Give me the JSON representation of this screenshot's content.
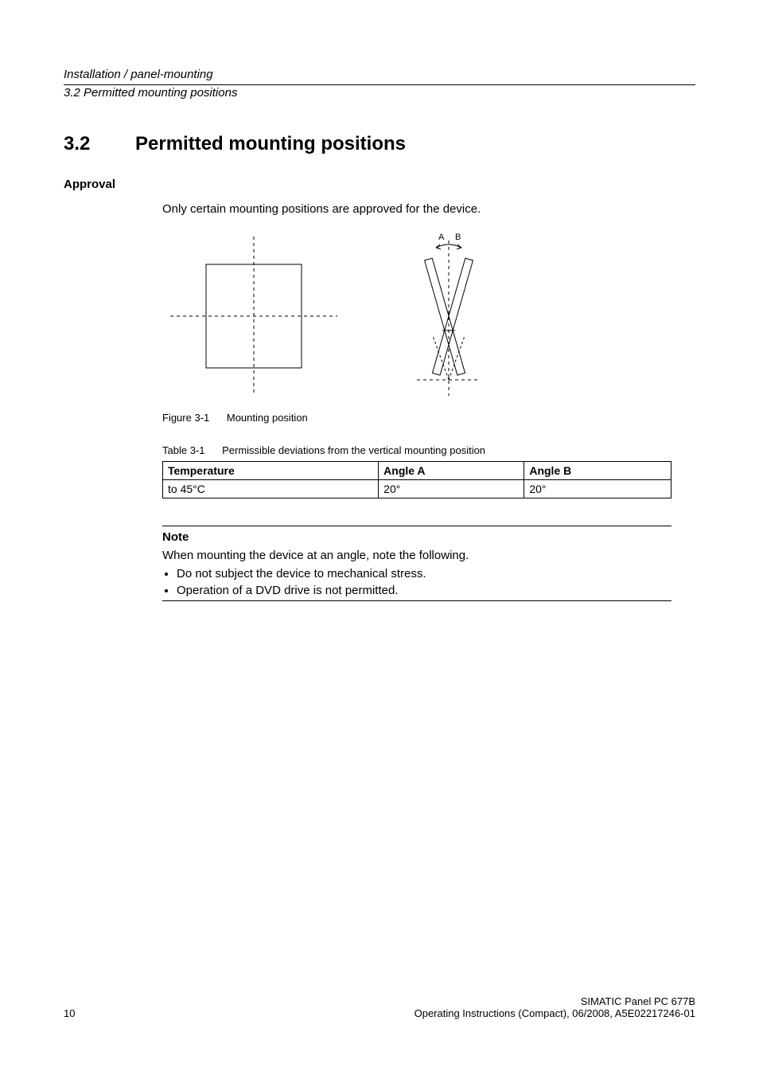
{
  "header": {
    "breadcrumb": "Installation / panel-mounting",
    "subheading": "3.2 Permitted mounting positions"
  },
  "section": {
    "number": "3.2",
    "title": "Permitted mounting positions"
  },
  "approval": {
    "heading": "Approval",
    "intro": "Only certain mounting positions are approved for the device."
  },
  "figure": {
    "label": "Figure 3-1",
    "caption": "Mounting position",
    "labels": {
      "A": "A",
      "B": "B"
    }
  },
  "table": {
    "label": "Table 3-1",
    "caption": "Permissible deviations from the vertical mounting position",
    "headers": {
      "temperature": "Temperature",
      "angleA": "Angle A",
      "angleB": "Angle B"
    },
    "rows": [
      {
        "temperature": "to 45°C",
        "angleA": "20°",
        "angleB": "20°"
      }
    ]
  },
  "note": {
    "title": "Note",
    "lead": "When mounting the device at an angle, note the following.",
    "items": [
      "Do not subject the device to mechanical stress.",
      "Operation of a DVD drive is not permitted."
    ]
  },
  "footer": {
    "pageNumber": "10",
    "line1": "SIMATIC Panel PC 677B",
    "line2": "Operating Instructions (Compact), 06/2008, A5E02217246-01"
  },
  "chart_data": {
    "type": "table",
    "title": "Permissible deviations from the vertical mounting position",
    "columns": [
      "Temperature",
      "Angle A",
      "Angle B"
    ],
    "rows": [
      [
        "to 45°C",
        "20°",
        "20°"
      ]
    ]
  }
}
